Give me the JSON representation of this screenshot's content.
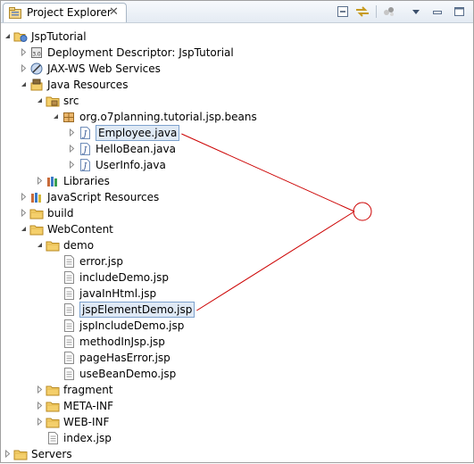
{
  "view": {
    "title": "Project Explorer",
    "close_glyph": "✕",
    "toolbar": [
      "collapse-all-icon",
      "link-with-editor-icon",
      "filter-icon",
      "view-menu-icon",
      "minimize-icon",
      "maximize-icon"
    ]
  },
  "tree": [
    {
      "label": "JspTutorial",
      "depth": 0,
      "expanded": true,
      "icon": "web-project-icon"
    },
    {
      "label": "Deployment Descriptor: JspTutorial",
      "depth": 1,
      "expanded": false,
      "icon": "deployment-descriptor-icon"
    },
    {
      "label": "JAX-WS Web Services",
      "depth": 1,
      "expanded": false,
      "icon": "web-services-icon"
    },
    {
      "label": "Java Resources",
      "depth": 1,
      "expanded": true,
      "icon": "java-resources-icon"
    },
    {
      "label": "src",
      "depth": 2,
      "expanded": true,
      "icon": "source-folder-icon"
    },
    {
      "label": "org.o7planning.tutorial.jsp.beans",
      "depth": 3,
      "expanded": true,
      "icon": "package-icon"
    },
    {
      "label": "Employee.java",
      "depth": 4,
      "expanded": false,
      "icon": "java-file-icon",
      "selected": true
    },
    {
      "label": "HelloBean.java",
      "depth": 4,
      "expanded": false,
      "icon": "java-file-icon"
    },
    {
      "label": "UserInfo.java",
      "depth": 4,
      "expanded": false,
      "icon": "java-file-icon"
    },
    {
      "label": "Libraries",
      "depth": 2,
      "expanded": false,
      "icon": "libraries-icon"
    },
    {
      "label": "JavaScript Resources",
      "depth": 1,
      "expanded": false,
      "icon": "javascript-resources-icon"
    },
    {
      "label": "build",
      "depth": 1,
      "expanded": false,
      "icon": "folder-icon"
    },
    {
      "label": "WebContent",
      "depth": 1,
      "expanded": true,
      "icon": "folder-icon"
    },
    {
      "label": "demo",
      "depth": 2,
      "expanded": true,
      "icon": "folder-icon"
    },
    {
      "label": "error.jsp",
      "depth": 3,
      "icon": "jsp-file-icon"
    },
    {
      "label": "includeDemo.jsp",
      "depth": 3,
      "icon": "jsp-file-icon"
    },
    {
      "label": "javaInHtml.jsp",
      "depth": 3,
      "icon": "jsp-file-icon"
    },
    {
      "label": "jspElementDemo.jsp",
      "depth": 3,
      "icon": "jsp-file-icon",
      "selected": true
    },
    {
      "label": "jspIncludeDemo.jsp",
      "depth": 3,
      "icon": "jsp-file-icon"
    },
    {
      "label": "methodInJsp.jsp",
      "depth": 3,
      "icon": "jsp-file-icon"
    },
    {
      "label": "pageHasError.jsp",
      "depth": 3,
      "icon": "jsp-file-icon"
    },
    {
      "label": "useBeanDemo.jsp",
      "depth": 3,
      "icon": "jsp-file-icon"
    },
    {
      "label": "fragment",
      "depth": 2,
      "expanded": false,
      "icon": "folder-icon"
    },
    {
      "label": "META-INF",
      "depth": 2,
      "expanded": false,
      "icon": "folder-icon"
    },
    {
      "label": "WEB-INF",
      "depth": 2,
      "expanded": false,
      "icon": "folder-icon"
    },
    {
      "label": "index.jsp",
      "depth": 2,
      "icon": "jsp-file-icon"
    },
    {
      "label": "Servers",
      "depth": 0,
      "expanded": false,
      "icon": "folder-icon"
    }
  ],
  "annotation": {
    "color": "#cc0000",
    "shape": "circle",
    "connects": [
      "Employee.java",
      "jspElementDemo.jsp"
    ]
  }
}
